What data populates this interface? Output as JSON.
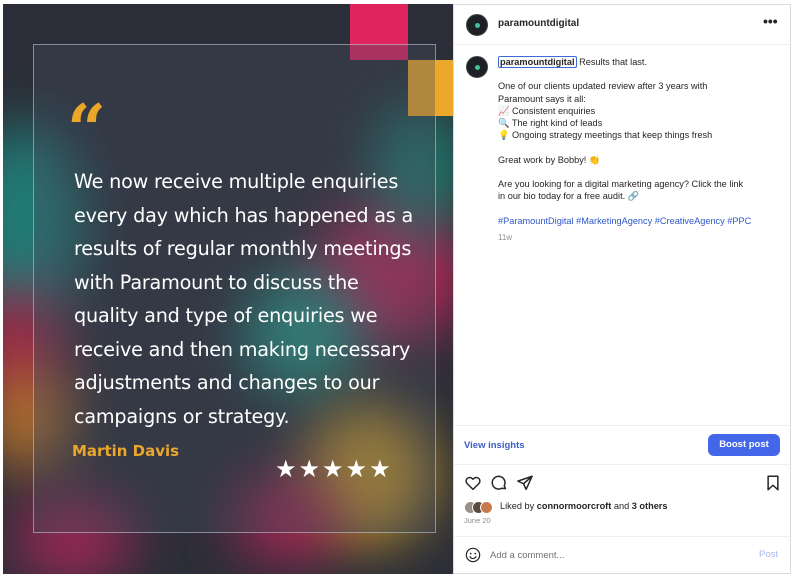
{
  "image": {
    "quote_mark": "“",
    "quote_text": "We now receive multiple enquiries every day which has happened as a results of regular monthly meetings with Paramount to discuss the quality and type of enquiries we receive and then making necessary adjustments and changes to our campaigns or strategy.",
    "author": "Martin Davis",
    "rating": 5,
    "stars": "★★★★★",
    "colors": {
      "accent_yellow": "#eaa72a",
      "accent_pink": "#e0245e",
      "background": "#2b2e38"
    }
  },
  "post": {
    "username": "paramountdigital",
    "more_icon": "more-horizontal-icon",
    "caption": {
      "username": "paramountdigital",
      "headline": "Results that last.",
      "line1": "One of our clients updated review after 3 years with",
      "line2": "Paramount says it all:",
      "bullet1": "📈 Consistent enquiries",
      "bullet2": "🔍 The right kind of leads",
      "bullet3": "💡 Ongoing strategy meetings that keep things fresh",
      "thanks": "Great work by Bobby! 👏",
      "cta1": "Are you looking for a digital marketing agency? Click the link",
      "cta2": "in our bio today for a free audit. 🔗",
      "hashtags": "#ParamountDigital #MarketingAgency #CreativeAgency #PPC",
      "time": "11w"
    },
    "view_insights": "View insights",
    "boost_post": "Boost post",
    "likes": {
      "prefix": "Liked by ",
      "user": "connormoorcroft",
      "middle": " and ",
      "others": "3 others"
    },
    "date": "June 20",
    "comment": {
      "placeholder": "Add a comment...",
      "post_label": "Post"
    },
    "colors": {
      "link": "#3a5fc8",
      "boost_bg": "#4466e8",
      "muted": "#8e8e8e"
    }
  }
}
